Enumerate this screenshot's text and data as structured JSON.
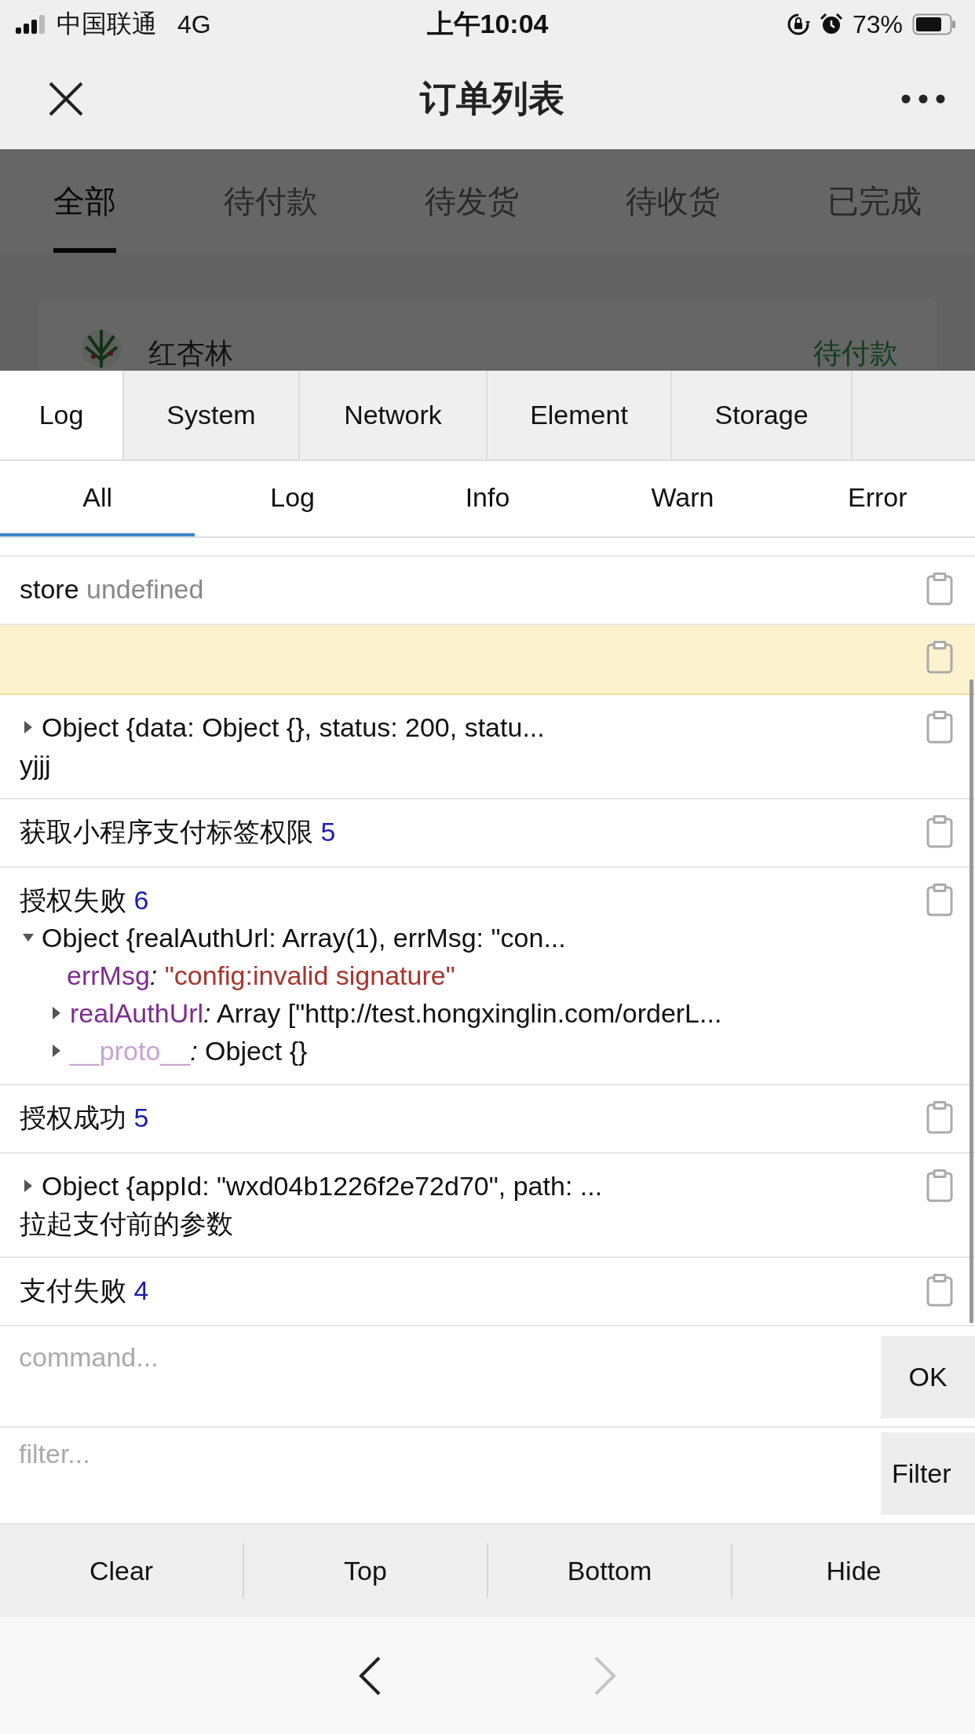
{
  "status_bar": {
    "carrier": "中国联通",
    "network": "4G",
    "time": "上午10:04",
    "battery": "73%"
  },
  "nav_bar": {
    "title": "订单列表"
  },
  "page": {
    "tabs": [
      {
        "label": "全部",
        "selected": true
      },
      {
        "label": "待付款",
        "selected": false
      },
      {
        "label": "待发货",
        "selected": false
      },
      {
        "label": "待收货",
        "selected": false
      },
      {
        "label": "已完成",
        "selected": false
      }
    ],
    "order_card": {
      "shop": "红杏林",
      "status": "待付款"
    }
  },
  "console": {
    "tabs": [
      {
        "label": "Log",
        "selected": true
      },
      {
        "label": "System",
        "selected": false
      },
      {
        "label": "Network",
        "selected": false
      },
      {
        "label": "Element",
        "selected": false
      },
      {
        "label": "Storage",
        "selected": false
      }
    ],
    "filters": [
      {
        "label": "All",
        "selected": true
      },
      {
        "label": "Log",
        "selected": false
      },
      {
        "label": "Info",
        "selected": false
      },
      {
        "label": "Warn",
        "selected": false
      },
      {
        "label": "Error",
        "selected": false
      }
    ],
    "logs": [
      {
        "warn": false,
        "items": [
          {
            "kind": "text",
            "text": "store",
            "note": "undefined"
          }
        ]
      },
      {
        "warn": true
      },
      {
        "warn": false,
        "items": [
          {
            "kind": "object",
            "expanded": false,
            "text": "Object {data: Object {}, status: 200, statu..."
          },
          {
            "kind": "text",
            "text": "yjjj"
          }
        ]
      },
      {
        "warn": false,
        "items": [
          {
            "kind": "text",
            "text": "获取小程序支付标签权限",
            "number": "5"
          }
        ]
      },
      {
        "warn": false,
        "items": [
          {
            "kind": "text",
            "text": "授权失败",
            "number": "6"
          },
          {
            "kind": "object",
            "expanded": true,
            "text": "Object {realAuthUrl: Array(1), errMsg: \"con...",
            "children": [
              {
                "kind": "string",
                "key": "errMsg",
                "separator": ":",
                "value": "\"config:invalid signature\""
              },
              {
                "kind": "object",
                "expanded": false,
                "key": "realAuthUrl",
                "separator": ":",
                "value": "Array [\"http://test.hongxinglin.com/orderL..."
              },
              {
                "kind": "prototype",
                "expanded": false,
                "key": "__proto__",
                "separator": ":",
                "value": "Object {}"
              }
            ]
          }
        ]
      },
      {
        "warn": false,
        "items": [
          {
            "kind": "text",
            "text": "授权成功",
            "number": "5"
          }
        ]
      },
      {
        "warn": false,
        "items": [
          {
            "kind": "object",
            "expanded": false,
            "text": "Object {appId: \"wxd04b1226f2e72d70\", path: ..."
          },
          {
            "kind": "text",
            "text": "拉起支付前的参数"
          }
        ]
      },
      {
        "warn": false,
        "items": [
          {
            "kind": "text",
            "text": "支付失败",
            "number": "4"
          }
        ]
      }
    ],
    "command": {
      "placeholder": "command...",
      "button": "OK"
    },
    "filter": {
      "placeholder": "filter...",
      "button": "Filter"
    },
    "actions": [
      "Clear",
      "Top",
      "Bottom",
      "Hide"
    ]
  },
  "browser_toolbar": {
    "back_disabled": false,
    "forward_disabled": true
  }
}
